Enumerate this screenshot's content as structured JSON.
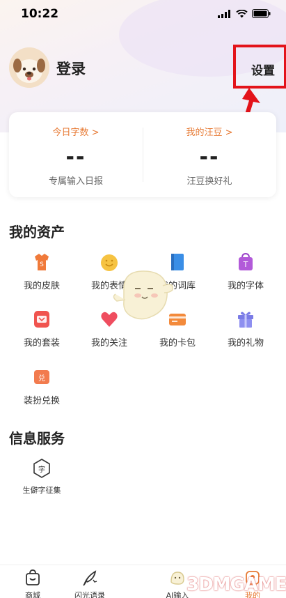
{
  "status_bar": {
    "time": "10:22"
  },
  "header": {
    "login_label": "登录",
    "settings_label": "设置"
  },
  "stats": {
    "today_words_title": "今日字数 >",
    "today_words_value": "--",
    "today_words_sub": "专属输入日报",
    "beans_title": "我的汪豆 >",
    "beans_value": "--",
    "beans_sub": "汪豆换好礼"
  },
  "assets": {
    "title": "我的资产",
    "items": [
      {
        "label": "我的皮肤",
        "icon": "shirt-icon"
      },
      {
        "label": "我的表情",
        "icon": "emoji-icon"
      },
      {
        "label": "我的词库",
        "icon": "book-icon"
      },
      {
        "label": "我的字体",
        "icon": "font-bag-icon"
      },
      {
        "label": "我的套装",
        "icon": "suit-icon"
      },
      {
        "label": "我的关注",
        "icon": "heart-icon"
      },
      {
        "label": "我的卡包",
        "icon": "card-wallet-icon"
      },
      {
        "label": "我的礼物",
        "icon": "gift-icon"
      },
      {
        "label": "装扮兑换",
        "icon": "exchange-icon"
      }
    ]
  },
  "services": {
    "title": "信息服务",
    "items": [
      {
        "label": "生僻字征集",
        "icon": "rare-char-icon"
      }
    ]
  },
  "tabs": [
    {
      "label": "商城",
      "icon": "shop-bag-icon"
    },
    {
      "label": "闪光语录",
      "icon": "quill-icon"
    },
    {
      "label": "AI输入",
      "icon": "ai-input-icon"
    },
    {
      "label": "",
      "icon": "blank"
    },
    {
      "label": "我的",
      "icon": "profile-icon"
    }
  ],
  "watermark": "3DMGAME",
  "colors": {
    "accent": "#e77a34",
    "annotation_red": "#e3131a"
  }
}
